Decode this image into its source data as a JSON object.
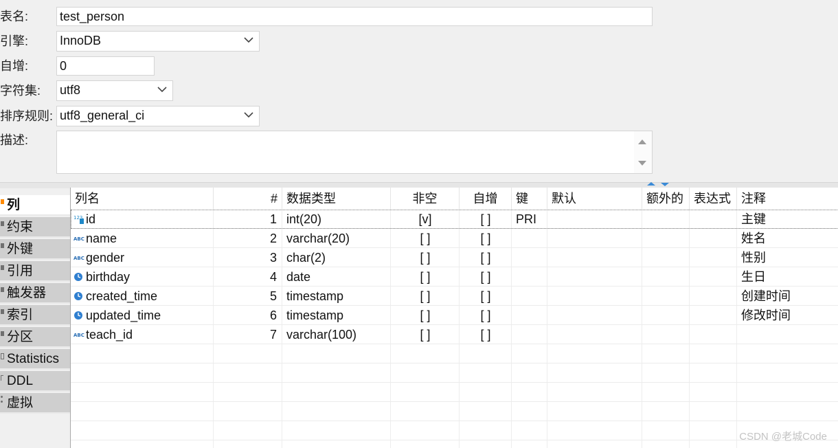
{
  "form": {
    "table_name_label": "表名:",
    "table_name_value": "test_person",
    "engine_label": "引擎:",
    "engine_value": "InnoDB",
    "auto_increment_label": "自增:",
    "auto_increment_value": "0",
    "charset_label": "字符集:",
    "charset_value": "utf8",
    "collation_label": "排序规则:",
    "collation_value": "utf8_general_ci",
    "description_label": "描述:"
  },
  "tabs": [
    {
      "label": "列"
    },
    {
      "label": "约束"
    },
    {
      "label": "外键"
    },
    {
      "label": "引用"
    },
    {
      "label": "触发器"
    },
    {
      "label": "索引"
    },
    {
      "label": "分区"
    },
    {
      "label": "Statistics"
    },
    {
      "label": "DDL"
    },
    {
      "label": "虚拟"
    }
  ],
  "columns_table": {
    "headers": [
      "列名",
      "#",
      "数据类型",
      "非空",
      "自增",
      "键",
      "默认",
      "额外的",
      "表达式",
      "注释"
    ],
    "rows": [
      {
        "icon": "numeric-column-icon",
        "name": "id",
        "num": "1",
        "type": "int(20)",
        "notnull": "[v]",
        "autoinc": "[ ]",
        "key": "PRI",
        "default": "",
        "extra": "",
        "expr": "",
        "comment": "主键"
      },
      {
        "icon": "text-column-icon",
        "name": "name",
        "num": "2",
        "type": "varchar(20)",
        "notnull": "[ ]",
        "autoinc": "[ ]",
        "key": "",
        "default": "",
        "extra": "",
        "expr": "",
        "comment": "姓名"
      },
      {
        "icon": "text-column-icon",
        "name": "gender",
        "num": "3",
        "type": "char(2)",
        "notnull": "[ ]",
        "autoinc": "[ ]",
        "key": "",
        "default": "",
        "extra": "",
        "expr": "",
        "comment": "性别"
      },
      {
        "icon": "date-column-icon",
        "name": "birthday",
        "num": "4",
        "type": "date",
        "notnull": "[ ]",
        "autoinc": "[ ]",
        "key": "",
        "default": "",
        "extra": "",
        "expr": "",
        "comment": "生日"
      },
      {
        "icon": "date-column-icon",
        "name": "created_time",
        "num": "5",
        "type": "timestamp",
        "notnull": "[ ]",
        "autoinc": "[ ]",
        "key": "",
        "default": "",
        "extra": "",
        "expr": "",
        "comment": "创建时间"
      },
      {
        "icon": "date-column-icon",
        "name": "updated_time",
        "num": "6",
        "type": "timestamp",
        "notnull": "[ ]",
        "autoinc": "[ ]",
        "key": "",
        "default": "",
        "extra": "",
        "expr": "",
        "comment": "修改时间"
      },
      {
        "icon": "text-column-icon",
        "name": "teach_id",
        "num": "7",
        "type": "varchar(100)",
        "notnull": "[ ]",
        "autoinc": "[ ]",
        "key": "",
        "default": "",
        "extra": "",
        "expr": "",
        "comment": ""
      }
    ]
  },
  "watermark": "CSDN @老城Code",
  "colors": {
    "active_tab_marker": "#ff8a00",
    "numeric_icon": "#1e88c8",
    "text_icon": "#2a6fb5",
    "date_icon": "#2f7fd0"
  }
}
